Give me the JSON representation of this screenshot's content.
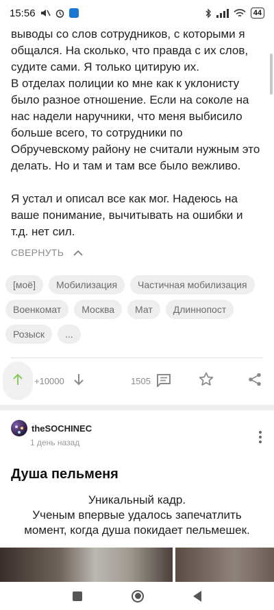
{
  "status_bar": {
    "time": "15:56",
    "battery": "44"
  },
  "post": {
    "paragraphs": [
      "выводы со слов сотрудников, с которыми я общался. На сколько, что правда с их слов, судите сами. Я только цитирую их.",
      "В отделах полиции ко мне как к уклонисту было разное отношение. Если на соколе на нас надели наручники, что меня выбисило больше всего, то сотрудники по Обручевскому району не считали нужным это делать. Но и там и там все было вежливо.",
      "Я устал и описал все как мог. Надеюсь на ваше понимание, вычитывать на ошибки и т.д. нет сил."
    ],
    "collapse_label": "СВЕРНУТЬ",
    "tags": [
      "[моё]",
      "Мобилизация",
      "Частичная мобилизация",
      "Военкомат",
      "Москва",
      "Мат",
      "Длиннопост",
      "Розыск",
      "..."
    ],
    "rating": "+10000",
    "comments_count": "1505"
  },
  "next_post": {
    "author": "theSOCHINEC",
    "time": "1 день назад",
    "title": "Душа пельменя",
    "caption_lines": [
      "Уникальный кадр.",
      "Ученым впервые удалось запечатлить",
      "момент, когда душа покидает пельмешек."
    ]
  },
  "colors": {
    "accent": "#8ac858",
    "muted": "#8a8a8a",
    "tag_bg": "#eeeeee"
  },
  "icons": {
    "vote_up": "arrow-up-icon",
    "vote_down": "arrow-down-icon",
    "comments": "comment-icon",
    "save": "star-icon",
    "share": "share-icon",
    "collapse": "chevron-up-icon"
  }
}
